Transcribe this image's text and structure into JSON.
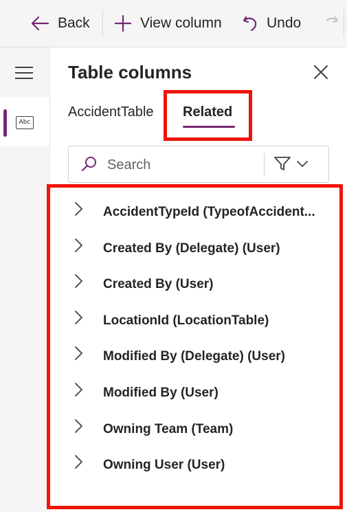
{
  "toolbar": {
    "back_label": "Back",
    "view_column_label": "View column",
    "undo_label": "Undo"
  },
  "panel": {
    "title": "Table columns",
    "tabs": [
      {
        "label": "AccidentTable",
        "selected": false
      },
      {
        "label": "Related",
        "selected": true
      }
    ],
    "search": {
      "placeholder": "Search",
      "value": ""
    },
    "items": [
      {
        "label": "AccidentTypeId (TypeofAccident..."
      },
      {
        "label": "Created By (Delegate) (User)"
      },
      {
        "label": "Created By (User)"
      },
      {
        "label": "LocationId (LocationTable)"
      },
      {
        "label": "Modified By (Delegate) (User)"
      },
      {
        "label": "Modified By (User)"
      },
      {
        "label": "Owning Team (Team)"
      },
      {
        "label": "Owning User (User)"
      }
    ]
  },
  "colors": {
    "accent": "#742774",
    "highlight": "#f0140c",
    "text": "#242424"
  }
}
